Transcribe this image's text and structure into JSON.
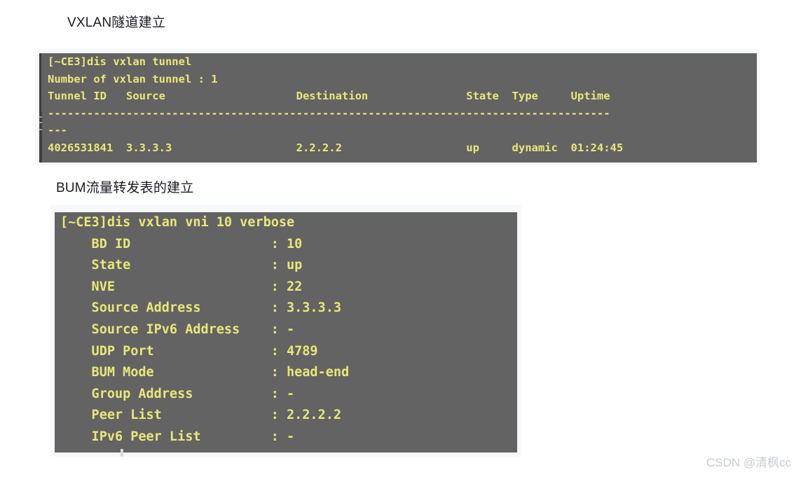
{
  "page": {
    "background_color": "#ffffff",
    "watermark": "CSDN @清枫cc"
  },
  "captions": {
    "tunnel": "VXLAN隧道建立",
    "bum": "BUM流量转发表的建立"
  },
  "terminals": [
    {
      "name": "vxlan-tunnel-output",
      "background_color": "#636363",
      "text_color": "#e8e879",
      "prompt": "[~CE3]",
      "command": "dis vxlan tunnel",
      "lines": [
        "[~CE3]dis vxlan tunnel",
        "Number of vxlan tunnel : 1",
        "Tunnel ID   Source                    Destination               State  Type     Uptime",
        "--------------------------------------------------------------------------------------",
        "---",
        "4026531841  3.3.3.3                   2.2.2.2                   up     dynamic  01:24:45"
      ],
      "table": {
        "columns": [
          "Tunnel ID",
          "Source",
          "Destination",
          "State",
          "Type",
          "Uptime"
        ],
        "rows": [
          [
            "4026531841",
            "3.3.3.3",
            "2.2.2.2",
            "up",
            "dynamic",
            "01:24:45"
          ]
        ],
        "tunnel_count_label": "Number of vxlan tunnel",
        "tunnel_count": "1"
      }
    },
    {
      "name": "vxlan-vni-verbose-output",
      "background_color": "#636363",
      "text_color": "#e8e879",
      "prompt": "[~CE3]",
      "command": "dis vxlan vni 10 verbose",
      "lines": [
        "[~CE3]dis vxlan vni 10 verbose",
        "    BD ID                  : 10",
        "    State                  : up",
        "    NVE                    : 22",
        "    Source Address         : 3.3.3.3",
        "    Source IPv6 Address    : -",
        "    UDP Port               : 4789",
        "    BUM Mode               : head-end",
        "    Group Address          : -",
        "    Peer List              : 2.2.2.2",
        "    IPv6 Peer List         : -"
      ],
      "fields": [
        {
          "label": "BD ID",
          "value": "10"
        },
        {
          "label": "State",
          "value": "up"
        },
        {
          "label": "NVE",
          "value": "22"
        },
        {
          "label": "Source Address",
          "value": "3.3.3.3"
        },
        {
          "label": "Source IPv6 Address",
          "value": "-"
        },
        {
          "label": "UDP Port",
          "value": "4789"
        },
        {
          "label": "BUM Mode",
          "value": "head-end"
        },
        {
          "label": "Group Address",
          "value": "-"
        },
        {
          "label": "Peer List",
          "value": "2.2.2.2"
        },
        {
          "label": "IPv6 Peer List",
          "value": "-"
        }
      ]
    }
  ]
}
